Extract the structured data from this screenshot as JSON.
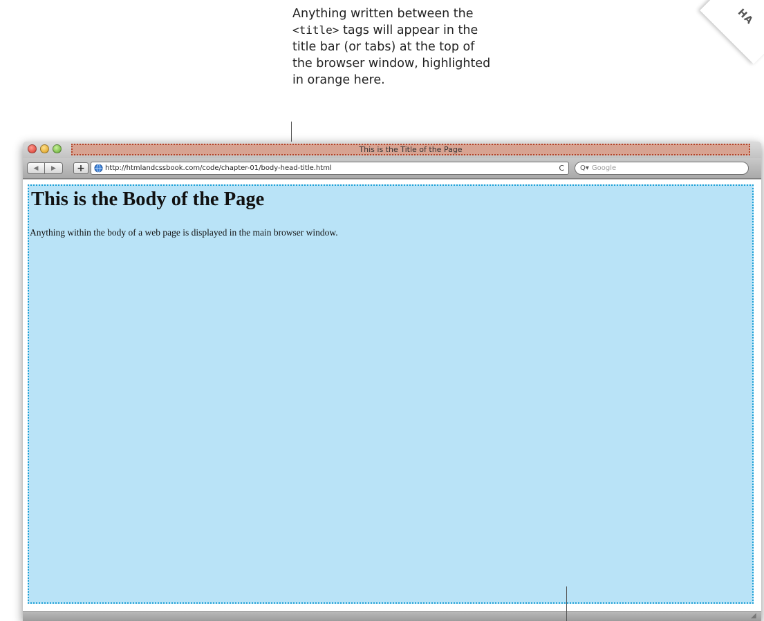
{
  "annotation": {
    "line1": "Anything written between the",
    "line2_mono": "<title>",
    "line2_rest": " tags will appear in the",
    "line3": "title bar (or tabs) at the top of",
    "line4": "the browser window, highlighted",
    "line5": "in orange here."
  },
  "corner_tab": {
    "label": "HA"
  },
  "window": {
    "title": "This is the Title of the Page",
    "title_highlight_color": "#d7a392",
    "title_highlight_border": "#b2452b"
  },
  "toolbar": {
    "back_label": "◀",
    "forward_label": "▶",
    "new_tab_label": "+",
    "address": "http://htmlandcssbook.com/code/chapter-01/body-head-title.html",
    "reload_label": "C",
    "search_icon": "Q▾",
    "search_placeholder": "Google"
  },
  "page": {
    "heading": "This is the Body of the Page",
    "paragraph": "Anything within the body of a web page is displayed in the main browser window.",
    "body_highlight_color": "#b9e3f7",
    "body_highlight_border": "#1a9fd6"
  },
  "statusbar": {
    "grip": "◢"
  }
}
